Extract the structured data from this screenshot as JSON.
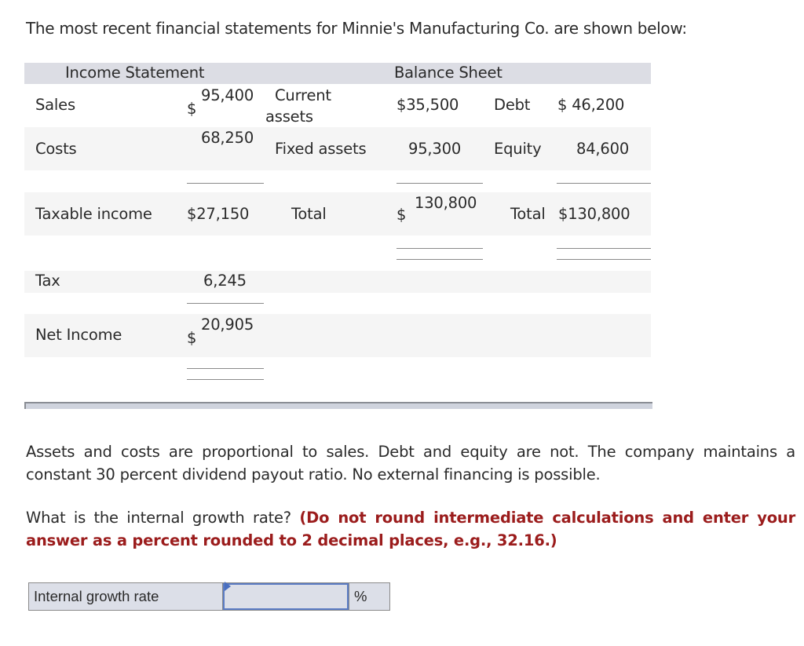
{
  "intro": "The most recent financial statements for Minnie's Manufacturing Co. are shown below:",
  "income_statement": {
    "title": "Income Statement",
    "rows": [
      {
        "label": "Sales",
        "currency": "$",
        "value": "95,400"
      },
      {
        "label": "Costs",
        "currency": "",
        "value": "68,250"
      },
      {
        "label": "Taxable income",
        "currency": "",
        "value": "$27,150"
      },
      {
        "label": "Tax",
        "currency": "",
        "value": "6,245"
      },
      {
        "label": "Net Income",
        "currency": "$",
        "value": "20,905"
      }
    ]
  },
  "balance_sheet": {
    "title": "Balance Sheet",
    "assets": [
      {
        "label_line1": "Current",
        "label_line2": "assets",
        "value": "$35,500"
      },
      {
        "label": "Fixed assets",
        "value": "95,300"
      },
      {
        "label": "Total",
        "currency": "$",
        "value": "130,800"
      }
    ],
    "liabilities": [
      {
        "label": "Debt",
        "value": "$ 46,200"
      },
      {
        "label": "Equity",
        "value": "84,600"
      },
      {
        "label": "Total",
        "value": "$130,800"
      }
    ]
  },
  "paragraph": "Assets and costs are proportional to sales. Debt and equity are not. The company maintains a constant 30 percent dividend payout ratio. No external financing is possible.",
  "question": {
    "text": "What is the internal growth rate?",
    "instruction": "(Do not round intermediate calculations and enter your answer as a percent rounded to 2 decimal places, e.g., 32.16.)"
  },
  "answer": {
    "label": "Internal growth rate",
    "value": "",
    "unit": "%"
  },
  "colors": {
    "header_band": "#dcdde4",
    "striped_row": "#f5f5f5",
    "instruction_red": "#9b1c1c",
    "input_border": "#5b7cc4"
  }
}
